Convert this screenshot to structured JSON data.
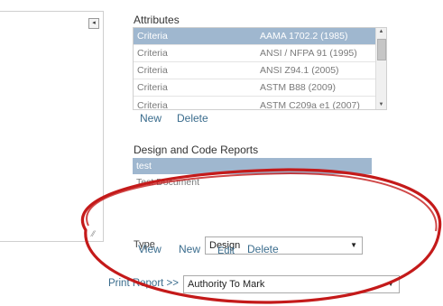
{
  "left_pane": {
    "scroll_icon": "left-arrow-icon",
    "grip_icon": "resize-grip-icon"
  },
  "attributes": {
    "title": "Attributes",
    "rows": [
      {
        "name": "Criteria",
        "value": "AAMA 1702.2 (1985)",
        "selected": true
      },
      {
        "name": "Criteria",
        "value": "ANSI / NFPA 91 (1995)",
        "selected": false
      },
      {
        "name": "Criteria",
        "value": "ANSI Z94.1 (2005)",
        "selected": false
      },
      {
        "name": "Criteria",
        "value": "ASTM B88 (2009)",
        "selected": false
      },
      {
        "name": "Criteria",
        "value": "ASTM C209a e1 (2007)",
        "selected": false
      }
    ],
    "new_label": "New",
    "delete_label": "Delete"
  },
  "design_reports": {
    "title": "Design and Code Reports",
    "rows": [
      {
        "name": "test",
        "selected": true
      },
      {
        "name": "Test Document",
        "selected": false
      }
    ]
  },
  "type_row": {
    "type_label": "Type",
    "view_label": "View",
    "new_label": "New",
    "edit_label": "Edit",
    "delete_label": "Delete",
    "select_value": "Design"
  },
  "print_report": {
    "label": "Print Report >>",
    "select_value": "Authority To Mark"
  },
  "colors": {
    "selection": "#9fb7cf",
    "link": "#3a6c8d",
    "annotation": "#c41a1a"
  }
}
